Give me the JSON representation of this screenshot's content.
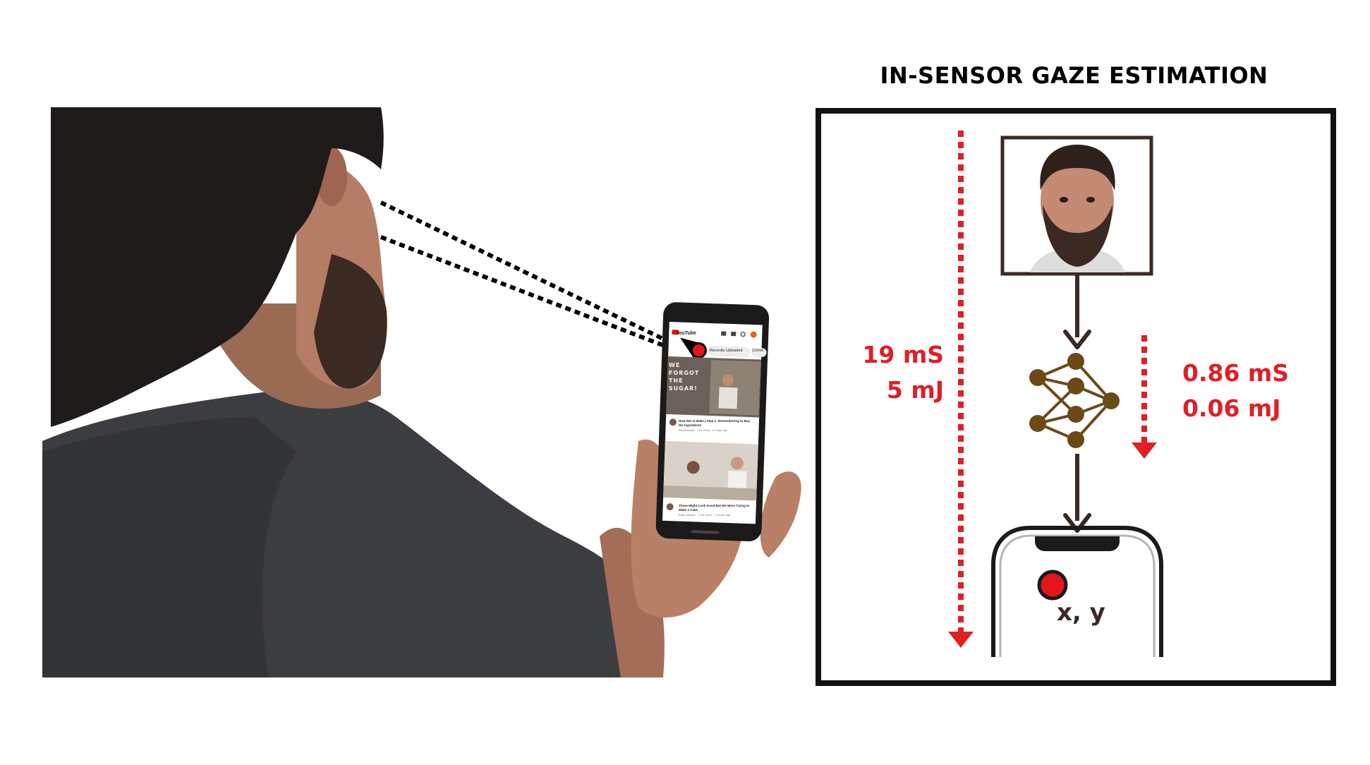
{
  "diagram": {
    "title": "IN-SENSOR GAZE ESTIMATION",
    "full_pipeline": {
      "latency": "19 mS",
      "energy": "5 mJ"
    },
    "in_sensor": {
      "latency": "0.86 mS",
      "energy": "0.06 mJ"
    },
    "output_label": "x, y"
  },
  "phone_screen": {
    "app_name": "YouTube",
    "chips": [
      "Recently Uploaded",
      "Comm"
    ],
    "thumbnail_text": [
      "WE",
      "FORGOT",
      "THE",
      "SUGAR!"
    ],
    "videos": [
      {
        "title": "How Not to Bake | Step 1: Remembering to Buy the Ingredients",
        "meta": "BakeMistake · 226 views · 12 days ago"
      },
      {
        "title": "These Might Look Good But We Were Trying to Make a Cake",
        "meta": "Bake Mistake · 1736 views · 1 month ago"
      }
    ]
  },
  "colors": {
    "metric_red": "#e01f26",
    "arrow_brown": "#3b2a22",
    "node_brown": "#6b4a18",
    "frame": "#111111",
    "gaze_dot": "#e3161c"
  }
}
